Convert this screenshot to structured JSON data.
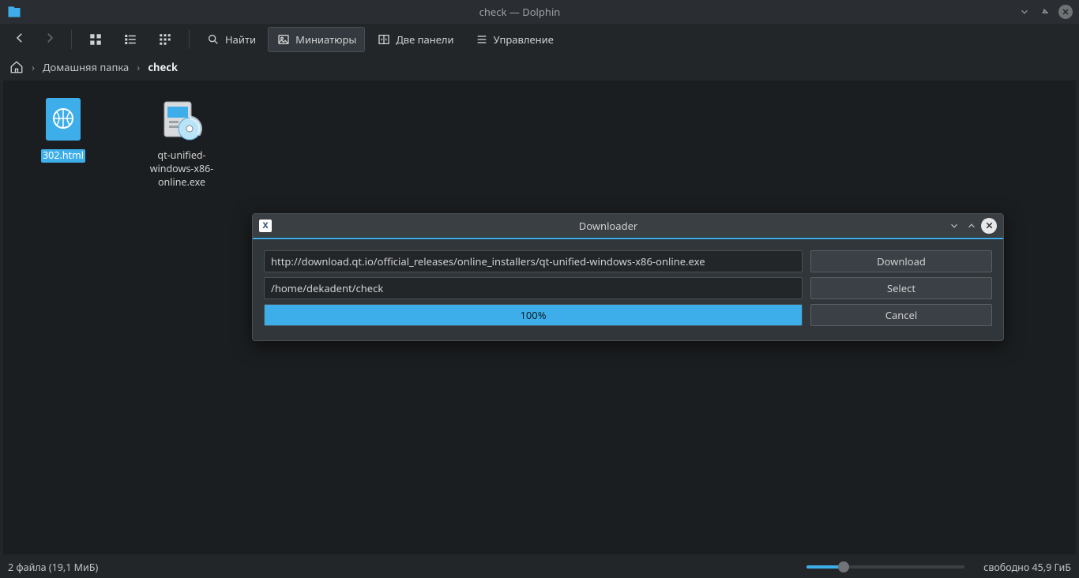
{
  "titlebar": {
    "title": "check — Dolphin"
  },
  "toolbar": {
    "find": "Найти",
    "thumbnails": "Миниатюры",
    "panels": "Две панели",
    "control": "Управление"
  },
  "breadcrumb": {
    "home": "Домашняя папка",
    "current": "check"
  },
  "files": [
    {
      "name": "302.html"
    },
    {
      "name": "qt-unified-windows-x86-online.exe"
    }
  ],
  "dialog": {
    "title": "Downloader",
    "url": "http://download.qt.io/official_releases/online_installers/qt-unified-windows-x86-online.exe",
    "path": "/home/dekadent/check",
    "progress_text": "100%",
    "download_btn": "Download",
    "select_btn": "Select",
    "cancel_btn": "Cancel"
  },
  "statusbar": {
    "left": "2 файла (19,1 МиБ)",
    "right": "свободно 45,9 ГиБ"
  }
}
